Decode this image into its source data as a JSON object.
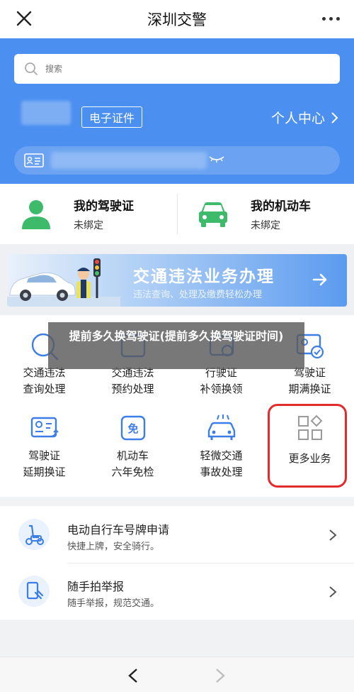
{
  "topbar": {
    "title": "深圳交警"
  },
  "hero": {
    "search_placeholder": "搜索",
    "cert_button": "电子证件",
    "personal_center": "个人中心"
  },
  "cards": [
    {
      "title": "我的驾驶证",
      "status": "未绑定",
      "icon": "person-icon"
    },
    {
      "title": "我的机动车",
      "status": "未绑定",
      "icon": "car-icon"
    }
  ],
  "banner": {
    "title": "交通违法业务办理",
    "subtitle": "违法查询、处理及缴费轻松办理"
  },
  "grid": [
    {
      "line1": "交通违法",
      "line2": "查询处理"
    },
    {
      "line1": "交通违法",
      "line2": "预约处理"
    },
    {
      "line1": "行驶证",
      "line2": "补领换领"
    },
    {
      "line1": "驾驶证",
      "line2": "期满换证"
    },
    {
      "line1": "驾驶证",
      "line2": "延期换证"
    },
    {
      "line1": "机动车",
      "line2": "六年免检"
    },
    {
      "line1": "轻微交通",
      "line2": "事故处理"
    },
    {
      "line1": "更多业务",
      "line2": ""
    }
  ],
  "overlay": {
    "caption": "提前多久换驾驶证(提前多久换驾驶证时间)"
  },
  "list": [
    {
      "title": "电动自行车号牌申请",
      "subtitle": "快捷上牌，安全骑行。"
    },
    {
      "title": "随手拍举报",
      "subtitle": "随手举报，规范交通。"
    }
  ],
  "colors": {
    "brand_blue": "#4b8ff0",
    "icon_green": "#3dbb6b",
    "highlight_red": "#e32b2b"
  }
}
